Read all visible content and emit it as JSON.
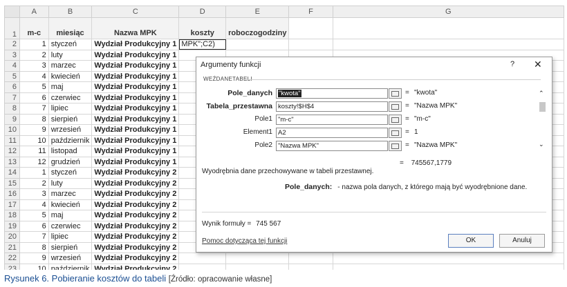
{
  "sheet": {
    "column_letters": [
      "A",
      "B",
      "C",
      "D",
      "E",
      "F",
      "G"
    ],
    "header_row_number": "1",
    "headers": [
      "m-c",
      "miesiąc",
      "Nazwa MPK",
      "koszty",
      "roboczogodziny",
      "",
      ""
    ],
    "editing_formula": "MPK\";C2)",
    "rows": [
      {
        "n": "2",
        "a": "1",
        "b": "styczeń",
        "c": "Wydział Produkcyjny 1"
      },
      {
        "n": "3",
        "a": "2",
        "b": "luty",
        "c": "Wydział Produkcyjny 1"
      },
      {
        "n": "4",
        "a": "3",
        "b": "marzec",
        "c": "Wydział Produkcyjny 1"
      },
      {
        "n": "5",
        "a": "4",
        "b": "kwiecień",
        "c": "Wydział Produkcyjny 1"
      },
      {
        "n": "6",
        "a": "5",
        "b": "maj",
        "c": "Wydział Produkcyjny 1"
      },
      {
        "n": "7",
        "a": "6",
        "b": "czerwiec",
        "c": "Wydział Produkcyjny 1"
      },
      {
        "n": "8",
        "a": "7",
        "b": "lipiec",
        "c": "Wydział Produkcyjny 1"
      },
      {
        "n": "9",
        "a": "8",
        "b": "sierpień",
        "c": "Wydział Produkcyjny 1"
      },
      {
        "n": "10",
        "a": "9",
        "b": "wrzesień",
        "c": "Wydział Produkcyjny 1"
      },
      {
        "n": "11",
        "a": "10",
        "b": "październik",
        "c": "Wydział Produkcyjny 1"
      },
      {
        "n": "12",
        "a": "11",
        "b": "listopad",
        "c": "Wydział Produkcyjny 1"
      },
      {
        "n": "13",
        "a": "12",
        "b": "grudzień",
        "c": "Wydział Produkcyjny 1"
      },
      {
        "n": "14",
        "a": "1",
        "b": "styczeń",
        "c": "Wydział Produkcyjny 2"
      },
      {
        "n": "15",
        "a": "2",
        "b": "luty",
        "c": "Wydział Produkcyjny 2"
      },
      {
        "n": "16",
        "a": "3",
        "b": "marzec",
        "c": "Wydział Produkcyjny 2"
      },
      {
        "n": "17",
        "a": "4",
        "b": "kwiecień",
        "c": "Wydział Produkcyjny 2"
      },
      {
        "n": "18",
        "a": "5",
        "b": "maj",
        "c": "Wydział Produkcyjny 2"
      },
      {
        "n": "19",
        "a": "6",
        "b": "czerwiec",
        "c": "Wydział Produkcyjny 2"
      },
      {
        "n": "20",
        "a": "7",
        "b": "lipiec",
        "c": "Wydział Produkcyjny 2"
      },
      {
        "n": "21",
        "a": "8",
        "b": "sierpień",
        "c": "Wydział Produkcyjny 2"
      },
      {
        "n": "22",
        "a": "9",
        "b": "wrzesień",
        "c": "Wydział Produkcyjny 2"
      },
      {
        "n": "23",
        "a": "10",
        "b": "październik",
        "c": "Wydział Produkcyjny 2"
      }
    ]
  },
  "dialog": {
    "title": "Argumenty funkcji",
    "help_symbol": "?",
    "close_symbol": "✕",
    "group_label": "WEŹDANETABELI",
    "args": [
      {
        "label": "Pole_danych",
        "value": "\"kwota\"",
        "result": "\"kwota\""
      },
      {
        "label": "Tabela_przestawna",
        "value": "koszty!$H$4",
        "result": "\"Nazwa MPK\""
      },
      {
        "label": "Pole1",
        "value": "\"m-c\"",
        "result": "\"m-c\""
      },
      {
        "label": "Element1",
        "value": "A2",
        "result": "1"
      },
      {
        "label": "Pole2",
        "value": "\"Nazwa MPK\"",
        "result": "\"Nazwa MPK\""
      }
    ],
    "equals": "=",
    "total": "745567,1779",
    "description": "Wyodrębnia dane przechowywane w tabeli przestawnej.",
    "arg_desc_label": "Pole_danych:",
    "arg_desc_text": "- nazwa pola danych, z którego mają być wyodrębnione dane.",
    "result_label": "Wynik formuły =",
    "result_value": "745 567",
    "help_link": "Pomoc dotycząca tej funkcji",
    "ok_label": "OK",
    "cancel_label": "Anuluj"
  },
  "caption": {
    "title": "Rysunek 6. Pobieranie kosztów do tabeli",
    "source": "[Źródło: opracowanie własne]"
  }
}
